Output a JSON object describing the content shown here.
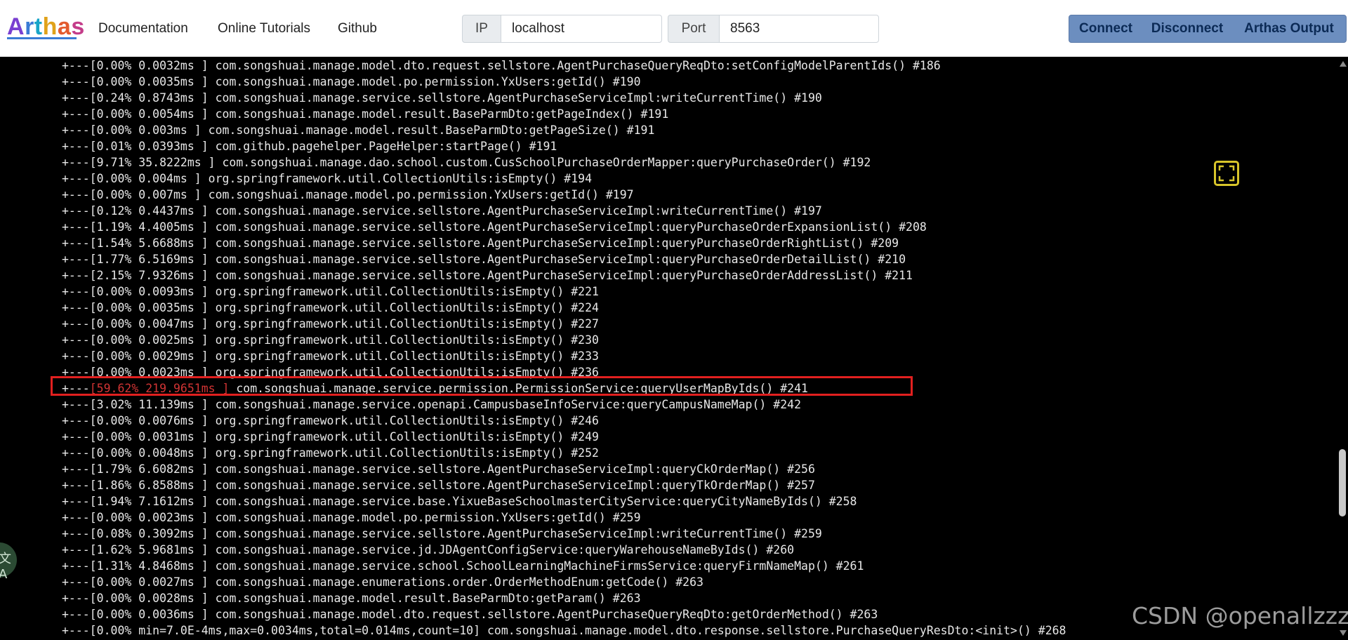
{
  "navbar": {
    "logo_text": "Arthas",
    "links": [
      "Documentation",
      "Online Tutorials",
      "Github"
    ],
    "ip": {
      "label": "IP",
      "value": "localhost"
    },
    "port": {
      "label": "Port",
      "value": "8563"
    },
    "buttons": [
      "Connect",
      "Disconnect",
      "Arthas Output"
    ]
  },
  "terminal": {
    "lines": [
      {
        "prefix": "+---",
        "time": "[0.00% 0.0032ms ]",
        "call": " com.songshuai.manage.model.dto.request.sellstore.AgentPurchaseQueryReqDto:setConfigModelParentIds() #186"
      },
      {
        "prefix": "+---",
        "time": "[0.00% 0.0035ms ]",
        "call": " com.songshuai.manage.model.po.permission.YxUsers:getId() #190"
      },
      {
        "prefix": "+---",
        "time": "[0.24% 0.8743ms ]",
        "call": " com.songshuai.manage.service.sellstore.AgentPurchaseServiceImpl:writeCurrentTime() #190"
      },
      {
        "prefix": "+---",
        "time": "[0.00% 0.0054ms ]",
        "call": " com.songshuai.manage.model.result.BaseParmDto:getPageIndex() #191"
      },
      {
        "prefix": "+---",
        "time": "[0.00% 0.003ms ]",
        "call": " com.songshuai.manage.model.result.BaseParmDto:getPageSize() #191"
      },
      {
        "prefix": "+---",
        "time": "[0.01% 0.0393ms ]",
        "call": " com.github.pagehelper.PageHelper:startPage() #191"
      },
      {
        "prefix": "+---",
        "time": "[9.71% 35.8222ms ]",
        "call": " com.songshuai.manage.dao.school.custom.CusSchoolPurchaseOrderMapper:queryPurchaseOrder() #192"
      },
      {
        "prefix": "+---",
        "time": "[0.00% 0.004ms ]",
        "call": " org.springframework.util.CollectionUtils:isEmpty() #194"
      },
      {
        "prefix": "+---",
        "time": "[0.00% 0.007ms ]",
        "call": " com.songshuai.manage.model.po.permission.YxUsers:getId() #197"
      },
      {
        "prefix": "+---",
        "time": "[0.12% 0.4437ms ]",
        "call": " com.songshuai.manage.service.sellstore.AgentPurchaseServiceImpl:writeCurrentTime() #197"
      },
      {
        "prefix": "+---",
        "time": "[1.19% 4.4005ms ]",
        "call": " com.songshuai.manage.service.sellstore.AgentPurchaseServiceImpl:queryPurchaseOrderExpansionList() #208"
      },
      {
        "prefix": "+---",
        "time": "[1.54% 5.6688ms ]",
        "call": " com.songshuai.manage.service.sellstore.AgentPurchaseServiceImpl:queryPurchaseOrderRightList() #209"
      },
      {
        "prefix": "+---",
        "time": "[1.77% 6.5169ms ]",
        "call": " com.songshuai.manage.service.sellstore.AgentPurchaseServiceImpl:queryPurchaseOrderDetailList() #210"
      },
      {
        "prefix": "+---",
        "time": "[2.15% 7.9326ms ]",
        "call": " com.songshuai.manage.service.sellstore.AgentPurchaseServiceImpl:queryPurchaseOrderAddressList() #211"
      },
      {
        "prefix": "+---",
        "time": "[0.00% 0.0093ms ]",
        "call": " org.springframework.util.CollectionUtils:isEmpty() #221"
      },
      {
        "prefix": "+---",
        "time": "[0.00% 0.0035ms ]",
        "call": " org.springframework.util.CollectionUtils:isEmpty() #224"
      },
      {
        "prefix": "+---",
        "time": "[0.00% 0.0047ms ]",
        "call": " org.springframework.util.CollectionUtils:isEmpty() #227"
      },
      {
        "prefix": "+---",
        "time": "[0.00% 0.0025ms ]",
        "call": " org.springframework.util.CollectionUtils:isEmpty() #230"
      },
      {
        "prefix": "+---",
        "time": "[0.00% 0.0029ms ]",
        "call": " org.springframework.util.CollectionUtils:isEmpty() #233"
      },
      {
        "prefix": "+---",
        "time": "[0.00% 0.0023ms ]",
        "call": " org.springframework.util.CollectionUtils:isEmpty() #236"
      },
      {
        "prefix": "+---",
        "time": "[59.62% 219.9651ms ]",
        "call": " com.songshuai.manage.service.permission.PermissionService:queryUserMapByIds() #241",
        "hot": true
      },
      {
        "prefix": "+---",
        "time": "[3.02% 11.139ms ]",
        "call": " com.songshuai.manage.service.openapi.CampusbaseInfoService:queryCampusNameMap() #242"
      },
      {
        "prefix": "+---",
        "time": "[0.00% 0.0076ms ]",
        "call": " org.springframework.util.CollectionUtils:isEmpty() #246"
      },
      {
        "prefix": "+---",
        "time": "[0.00% 0.0031ms ]",
        "call": " org.springframework.util.CollectionUtils:isEmpty() #249"
      },
      {
        "prefix": "+---",
        "time": "[0.00% 0.0048ms ]",
        "call": " org.springframework.util.CollectionUtils:isEmpty() #252"
      },
      {
        "prefix": "+---",
        "time": "[1.79% 6.6082ms ]",
        "call": " com.songshuai.manage.service.sellstore.AgentPurchaseServiceImpl:queryCkOrderMap() #256"
      },
      {
        "prefix": "+---",
        "time": "[1.86% 6.8588ms ]",
        "call": " com.songshuai.manage.service.sellstore.AgentPurchaseServiceImpl:queryTkOrderMap() #257"
      },
      {
        "prefix": "+---",
        "time": "[1.94% 7.1612ms ]",
        "call": " com.songshuai.manage.service.base.YixueBaseSchoolmasterCityService:queryCityNameByIds() #258"
      },
      {
        "prefix": "+---",
        "time": "[0.00% 0.0023ms ]",
        "call": " com.songshuai.manage.model.po.permission.YxUsers:getId() #259"
      },
      {
        "prefix": "+---",
        "time": "[0.08% 0.3092ms ]",
        "call": " com.songshuai.manage.service.sellstore.AgentPurchaseServiceImpl:writeCurrentTime() #259"
      },
      {
        "prefix": "+---",
        "time": "[1.62% 5.9681ms ]",
        "call": " com.songshuai.manage.service.jd.JDAgentConfigService:queryWarehouseNameByIds() #260"
      },
      {
        "prefix": "+---",
        "time": "[1.31% 4.8468ms ]",
        "call": " com.songshuai.manage.service.school.SchoolLearningMachineFirmsService:queryFirmNameMap() #261"
      },
      {
        "prefix": "+---",
        "time": "[0.00% 0.0027ms ]",
        "call": " com.songshuai.manage.enumerations.order.OrderMethodEnum:getCode() #263"
      },
      {
        "prefix": "+---",
        "time": "[0.00% 0.0028ms ]",
        "call": " com.songshuai.manage.model.result.BaseParmDto:getParam() #263"
      },
      {
        "prefix": "+---",
        "time": "[0.00% 0.0036ms ]",
        "call": " com.songshuai.manage.model.dto.request.sellstore.AgentPurchaseQueryReqDto:getOrderMethod() #263"
      },
      {
        "prefix": "+---",
        "time": "[0.00% min=7.0E-4ms,max=0.0034ms,total=0.014ms,count=10]",
        "call": " com.songshuai.manage.model.dto.response.sellstore.PurchaseQueryResDto:<init>() #268"
      }
    ]
  },
  "colors": {
    "terminal_bg": "#000000",
    "terminal_text": "#e8e8e8",
    "hot_text": "#d23434",
    "highlight_border": "#e1201f",
    "button_bg": "#6c8ebf",
    "button_text": "#0b2a55"
  },
  "icons": {
    "fullscreen": "fullscreen-icon",
    "translate": "translate-icon"
  },
  "translate_glyph": "文A",
  "watermark": "CSDN @openallzzz"
}
